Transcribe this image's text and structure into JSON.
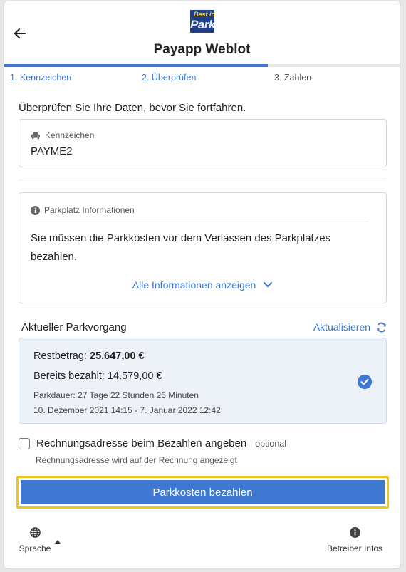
{
  "header": {
    "title": "Payapp Weblot",
    "logo_text_top": "Best in",
    "logo_text_bottom": "Parking",
    "progress_fraction": 0.667
  },
  "steps": [
    {
      "label": "1. Kennzeichen",
      "state": "done"
    },
    {
      "label": "2. Überprüfen",
      "state": "done"
    },
    {
      "label": "3. Zahlen",
      "state": "current"
    }
  ],
  "intro": "Überprüfen Sie Ihre Daten, bevor Sie fortfahren.",
  "plate": {
    "label": "Kennzeichen",
    "value": "PAYME2",
    "icon": "car-icon"
  },
  "info": {
    "title": "Parkplatz Informationen",
    "icon": "info-circle-icon",
    "text": "Sie müssen die Parkkosten vor dem Verlassen des Parkplatzes bezahlen.",
    "link": "Alle Informationen anzeigen"
  },
  "session": {
    "heading": "Aktueller Parkvorgang",
    "refresh_label": "Aktualisieren",
    "balance_label": "Restbetrag:",
    "balance_value": "25.647,00 €",
    "paid_label": "Bereits bezahlt:",
    "paid_value": "14.579,00 €",
    "duration": "Parkdauer: 27 Tage 22 Stunden 26 Minuten",
    "period": "10. Dezember 2021 14:15 - 7. Januar 2022 12:42"
  },
  "billing": {
    "label": "Rechnungsadresse beim Bezahlen angeben",
    "optional": "optional",
    "hint": "Rechnungsadresse wird auf der Rechnung angezeigt",
    "checked": false
  },
  "pay_button": "Parkkosten bezahlen",
  "footer": {
    "language": "Sprache",
    "operator": "Betreiber Infos"
  },
  "colors": {
    "accent": "#3f78d3",
    "highlight": "#f2c41c",
    "session_bg": "#edf1f8"
  }
}
